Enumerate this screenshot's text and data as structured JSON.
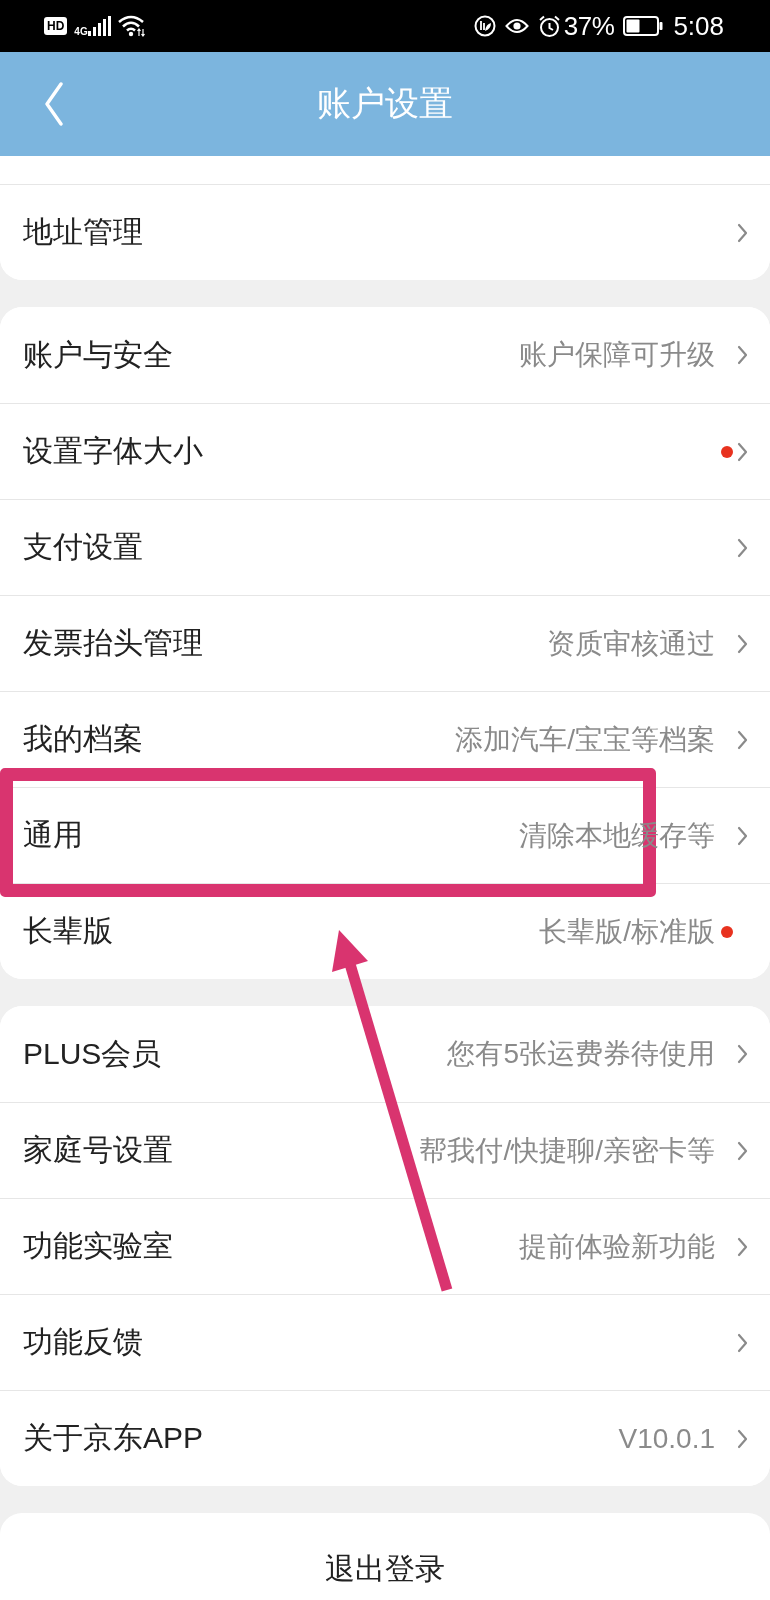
{
  "status_bar": {
    "hd_badge": "HD",
    "network": "4G",
    "battery_percent": "37%",
    "time": "5:08"
  },
  "header": {
    "title": "账户设置"
  },
  "sections": [
    {
      "partial_top": true,
      "rows": [
        {
          "label": "地址管理",
          "dot": false,
          "chevron": true,
          "highlighted": false
        }
      ]
    },
    {
      "partial_top": false,
      "rows": [
        {
          "label": "账户与安全",
          "value": "账户保障可升级",
          "dot": false,
          "chevron": true,
          "highlighted": false
        },
        {
          "label": "设置字体大小",
          "dot": true,
          "chevron": true,
          "highlighted": false
        },
        {
          "label": "支付设置",
          "dot": false,
          "chevron": true,
          "highlighted": false
        },
        {
          "label": "发票抬头管理",
          "value": "资质审核通过",
          "dot": false,
          "chevron": true,
          "highlighted": false
        },
        {
          "label": "我的档案",
          "value": "添加汽车/宝宝等档案",
          "dot": false,
          "chevron": true,
          "highlighted": false
        },
        {
          "label": "通用",
          "value": "清除本地缓存等",
          "dot": false,
          "chevron": true,
          "highlighted": true
        },
        {
          "label": "长辈版",
          "value": "长辈版/标准版",
          "dot": true,
          "chevron": false,
          "highlighted": false
        }
      ]
    },
    {
      "partial_top": false,
      "rows": [
        {
          "label": "PLUS会员",
          "value": "您有5张运费券待使用",
          "dot": false,
          "chevron": true,
          "highlighted": false
        },
        {
          "label": "家庭号设置",
          "value": "帮我付/快捷聊/亲密卡等",
          "dot": false,
          "chevron": true,
          "highlighted": false
        },
        {
          "label": "功能实验室",
          "value": "提前体验新功能",
          "dot": false,
          "chevron": true,
          "highlighted": false
        },
        {
          "label": "功能反馈",
          "dot": false,
          "chevron": true,
          "highlighted": false
        },
        {
          "label": "关于京东APP",
          "value": "V10.0.1",
          "dot": false,
          "chevron": true,
          "highlighted": false
        }
      ]
    }
  ],
  "logout_button": "退出登录",
  "annotations": [
    {
      "kind": "arrow"
    }
  ]
}
